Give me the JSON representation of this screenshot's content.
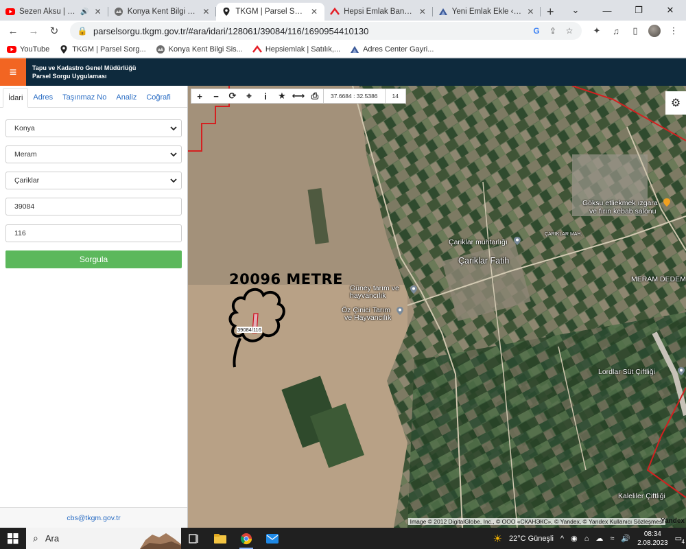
{
  "browser": {
    "tabs": [
      {
        "title": "Sezen Aksu | Gelecek",
        "favicon": "youtube-icon",
        "extra": "speaker-icon",
        "active": false
      },
      {
        "title": "Konya Kent Bilgi Sistemi",
        "favicon": "city-logo-icon",
        "active": false
      },
      {
        "title": "TKGM | Parsel Sorgu Uyg",
        "favicon": "location-pin-icon",
        "active": true
      },
      {
        "title": "Hepsi Emlak Bana Özel",
        "favicon": "hepsiemlak-icon",
        "active": false
      },
      {
        "title": "Yeni Emlak Ekle ‹ Adres C",
        "favicon": "adres-center-icon",
        "active": false
      }
    ],
    "url": "parselsorgu.tkgm.gov.tr/#ara/idari/128061/39084/116/1690954410130",
    "bookmarks": [
      {
        "label": "YouTube",
        "icon": "youtube-icon"
      },
      {
        "label": "TKGM | Parsel Sorg...",
        "icon": "location-pin-icon"
      },
      {
        "label": "Konya Kent Bilgi Sis...",
        "icon": "city-logo-icon"
      },
      {
        "label": "Hepsiemlak | Satılık,...",
        "icon": "hepsiemlak-icon"
      },
      {
        "label": "Adres Center Gayri...",
        "icon": "adres-center-icon"
      }
    ]
  },
  "app": {
    "title_line1": "Tapu ve Kadastro Genel Müdürlüğü",
    "title_line2": "Parsel Sorgu Uygulaması",
    "accent": "#f26522",
    "header_bg": "#0e2a3d"
  },
  "panel": {
    "tabs": [
      "İdari",
      "Adres",
      "Taşınmaz No",
      "Analiz",
      "Coğrafi"
    ],
    "active_tab": "İdari",
    "province": "Konya",
    "district": "Meram",
    "neighborhood": "Çariklar",
    "block": "39084",
    "parcel": "116",
    "query_button": "Sorgula",
    "query_button_color": "#5cb85c",
    "footer_email": "cbs@tkgm.gov.tr"
  },
  "map": {
    "coordinates": "37.6684 : 32.5386",
    "zoom": "14",
    "annotation": "20096 METRE",
    "parcel_label": "39084/116",
    "places": [
      "Göksu etliekmek ızgara",
      "ve fırın kebab salonu",
      "Çariklar muhtarlığı",
      "Çariklar Fatih",
      "Güney tarım ve",
      "hayvancılık",
      "Öz Çinici Tarım",
      "ve Hayvancılık",
      "MERAM DEDEM",
      "Lordlar Süt Çiftliği",
      "Kaleliler Çiftliği",
      "ÇARIKLAR MAH."
    ],
    "attribution": "Image © 2012 DigitalGlobe, Inc., © ООО «СКАНЭКС», © Yandex, © Yandex Kullanıcı Sözleşmesi",
    "provider": "Yandex"
  },
  "taskbar": {
    "search_placeholder": "Ara",
    "weather": "22°C  Güneşli",
    "time": "08:34",
    "date": "2.08.2023",
    "notifications": "4"
  }
}
